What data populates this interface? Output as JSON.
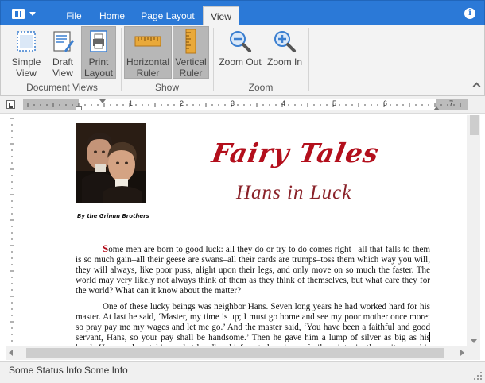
{
  "app": {
    "tabs": [
      {
        "label": "File",
        "active": false
      },
      {
        "label": "Home",
        "active": false
      },
      {
        "label": "Page Layout",
        "active": false
      },
      {
        "label": "View",
        "active": true
      }
    ],
    "info_icon": "info-icon"
  },
  "ribbon": {
    "groups": [
      {
        "label": "Document Views",
        "buttons": [
          {
            "label": "Simple View",
            "icon": "simple-view-icon",
            "selected": false
          },
          {
            "label": "Draft View",
            "icon": "draft-view-icon",
            "selected": false
          },
          {
            "label": "Print Layout",
            "icon": "print-layout-icon",
            "selected": true
          }
        ]
      },
      {
        "label": "Show",
        "buttons": [
          {
            "label": "Horizontal Ruler",
            "icon": "horizontal-ruler-icon",
            "selected": true
          },
          {
            "label": "Vertical Ruler",
            "icon": "vertical-ruler-icon",
            "selected": true
          }
        ]
      },
      {
        "label": "Zoom",
        "buttons": [
          {
            "label": "Zoom Out",
            "icon": "zoom-out-icon",
            "selected": false
          },
          {
            "label": "Zoom In",
            "icon": "zoom-in-icon",
            "selected": false
          }
        ]
      }
    ]
  },
  "document": {
    "byline": "By the Grimm Brothers",
    "title": "Fairy Tales",
    "subtitle": "Hans in Luck",
    "paragraph1_dropcap": "S",
    "paragraph1": "ome men are born to good luck: all they do or try to do comes right– all that falls to them is so much gain–all their geese are swans–all their cards are trumps–toss them which way you will, they will always, like poor puss, alight upon their legs, and only move on so much the faster. The world may very likely not always think of them as they think of themselves, but what care they for the world? What can it know about the matter?",
    "paragraph2": "One of these lucky beings was neighbor Hans. Seven long years he had worked hard for his master. At last he said, ‘Master, my time is up; I must go home and see my poor mother once more: so pray pay me my wages and let me go.’ And the master said, ‘You have been a faithful and good servant, Hans, so your pay shall be handsome.’ Then he gave him a lump of silver as big as his head. Hans took out his pocket-handkerchief, put the piece of silver into it, threw it over his shoulder, and jogged off on his road homewards."
  },
  "ruler": {
    "numbers": [
      "1",
      "2",
      "3",
      "4",
      "5",
      "6",
      "7"
    ]
  },
  "statusbar": {
    "items": [
      "Some Status Info",
      "Some Info"
    ]
  },
  "colors": {
    "accent": "#2b79d7",
    "title_red": "#b30f1c",
    "ribbon_bg": "#f3f3f3",
    "selected_btn": "#b7b7b7"
  }
}
